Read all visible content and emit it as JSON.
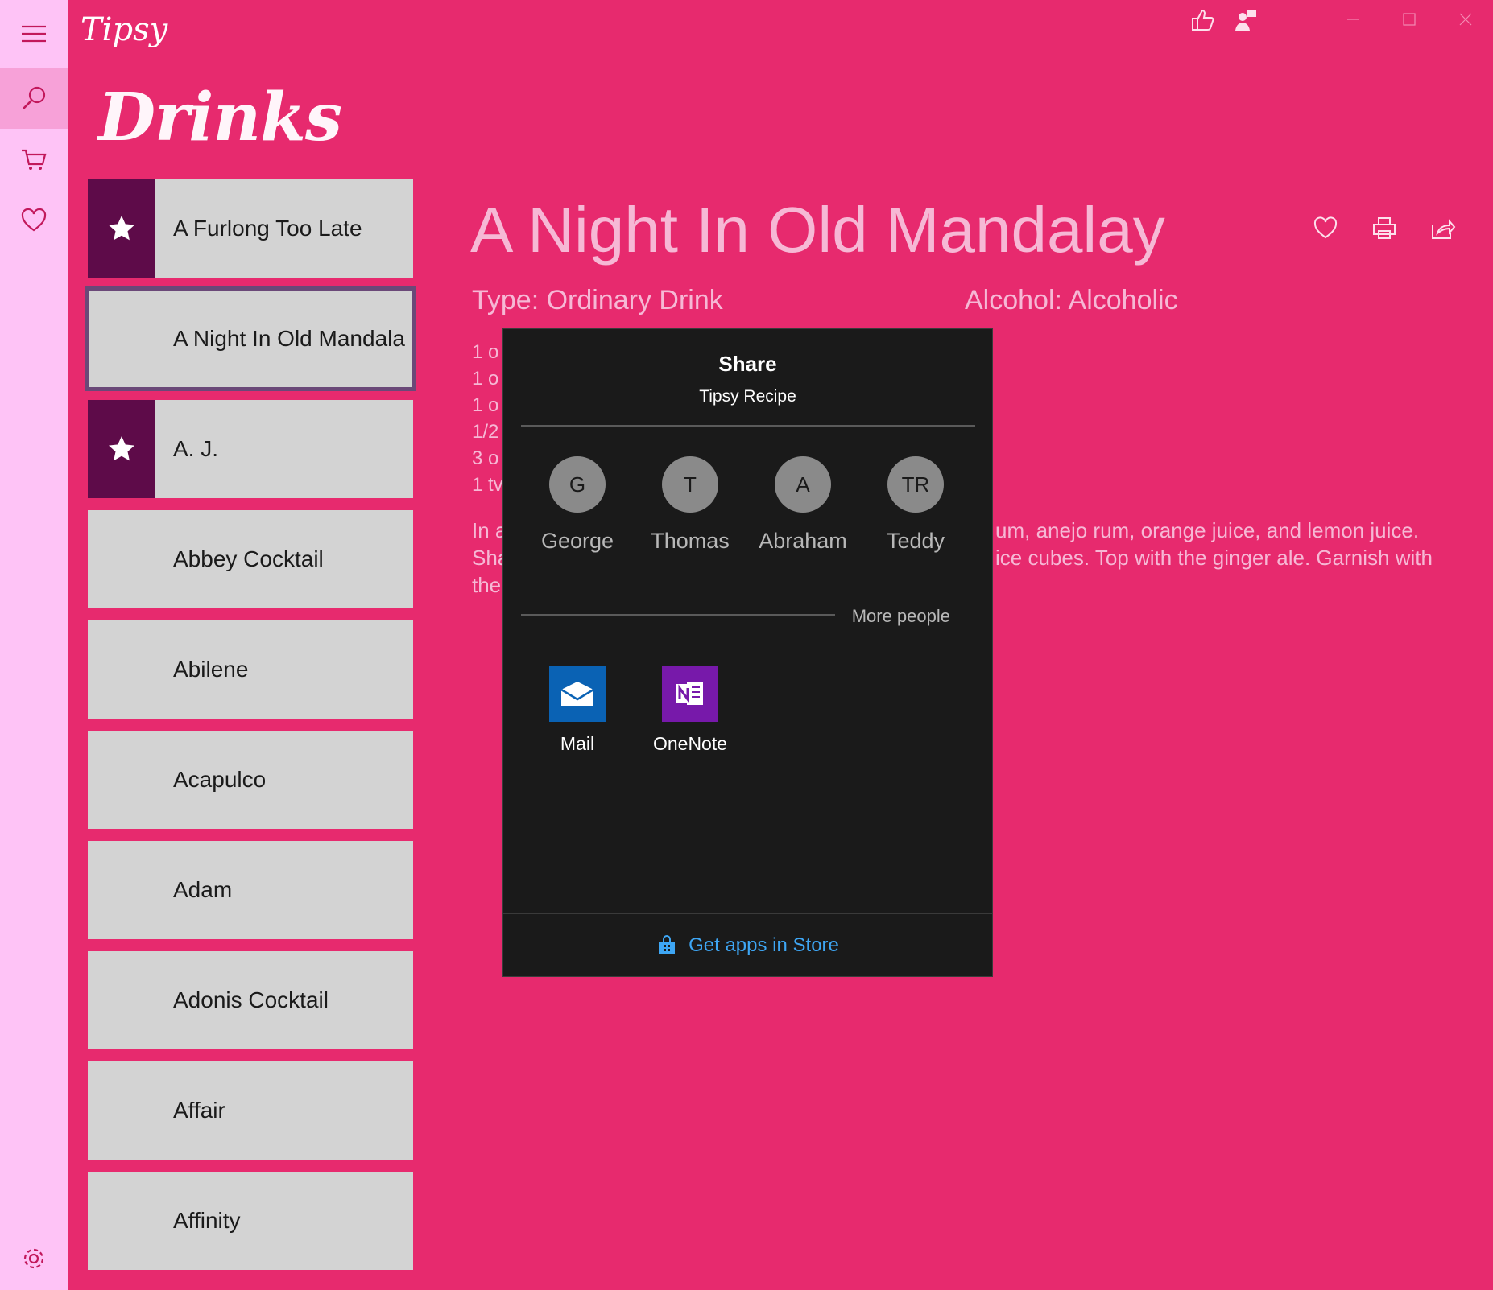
{
  "app": {
    "logo": "Tipsy",
    "heading": "Drinks"
  },
  "nav": {
    "items": [
      {
        "name": "menu",
        "icon": "hamburger-icon"
      },
      {
        "name": "search",
        "icon": "search-icon",
        "active": true
      },
      {
        "name": "cart",
        "icon": "cart-icon"
      },
      {
        "name": "favorites",
        "icon": "heart-icon"
      },
      {
        "name": "settings",
        "icon": "gear-icon"
      }
    ]
  },
  "drinks": [
    {
      "label": "A Furlong Too Late",
      "starred": true
    },
    {
      "label": "A Night In Old Mandala",
      "selected": true
    },
    {
      "label": "A. J.",
      "starred": true
    },
    {
      "label": "Abbey Cocktail"
    },
    {
      "label": "Abilene"
    },
    {
      "label": "Acapulco"
    },
    {
      "label": "Adam"
    },
    {
      "label": "Adonis Cocktail"
    },
    {
      "label": "Affair"
    },
    {
      "label": "Affinity"
    }
  ],
  "detail": {
    "title": "A Night In Old Mandalay",
    "type": "Type: Ordinary Drink",
    "alcohol": "Alcohol: Alcoholic",
    "ingredients": [
      "1 o",
      "1 o",
      "1 o",
      "1/2",
      "3 o",
      "1 tv"
    ],
    "instructions_left": [
      "In a",
      "Sha",
      "the"
    ],
    "instructions_right": [
      "um, anejo rum, orange juice, and lemon juice.",
      "ice cubes. Top with the ginger ale. Garnish with"
    ]
  },
  "share": {
    "title": "Share",
    "subtitle": "Tipsy Recipe",
    "people": [
      {
        "initials": "G",
        "name": "George"
      },
      {
        "initials": "T",
        "name": "Thomas"
      },
      {
        "initials": "A",
        "name": "Abraham"
      },
      {
        "initials": "TR",
        "name": "Teddy"
      }
    ],
    "more_people": "More people",
    "apps": [
      {
        "name": "Mail",
        "icon": "mail-icon",
        "color": "#0a62b4"
      },
      {
        "name": "OneNote",
        "icon": "onenote-icon",
        "color": "#7719aa"
      }
    ],
    "store_link": "Get apps in Store"
  },
  "colors": {
    "background": "#e72a6e",
    "rail": "#fec3f6",
    "star_tile": "#5e0b49",
    "list_item": "#d3d3d3",
    "flyout": "#1a1a1a",
    "link": "#3ea6f4"
  }
}
